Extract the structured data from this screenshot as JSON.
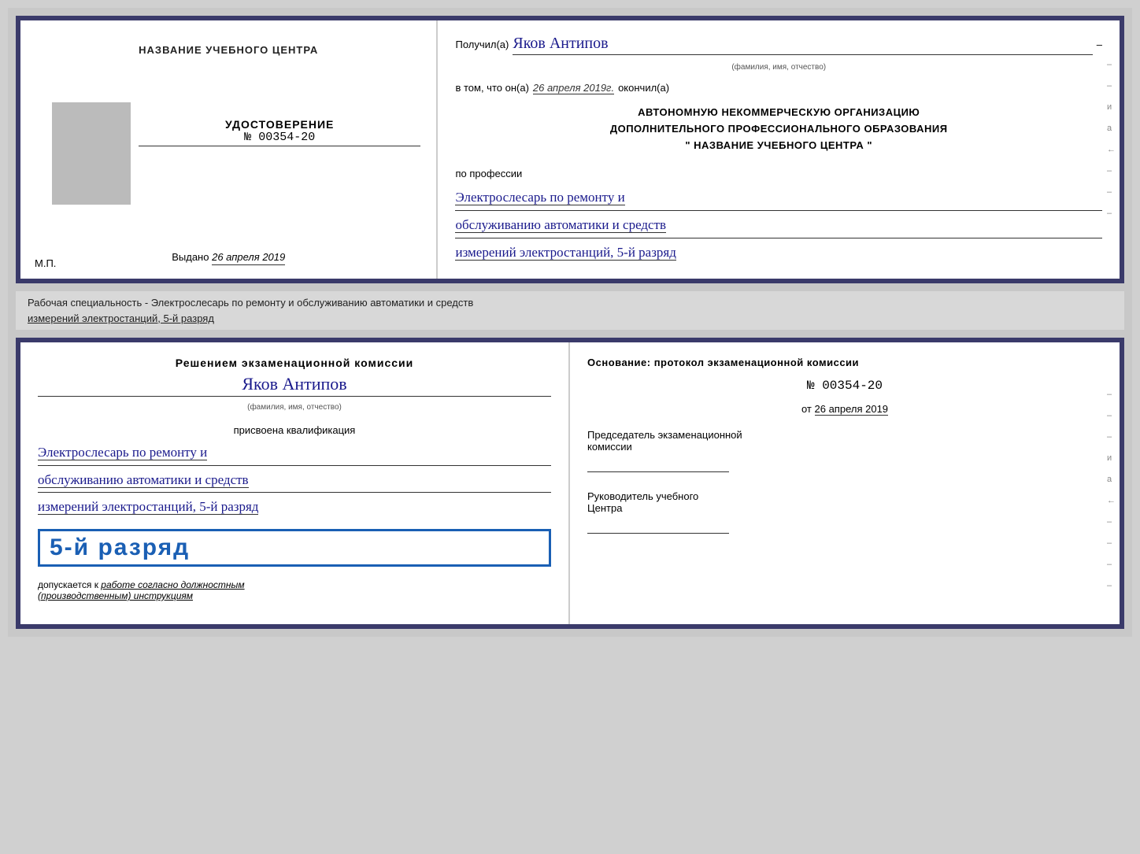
{
  "topDoc": {
    "left": {
      "title": "НАЗВАНИЕ УЧЕБНОГО ЦЕНТРА",
      "udostoverenie": "УДОСТОВЕРЕНИЕ",
      "number": "№ 00354-20",
      "vydano_label": "Выдано",
      "vydano_date": "26 апреля 2019",
      "mp": "М.П."
    },
    "right": {
      "poluchil_label": "Получил(a)",
      "name_handwritten": "Яков Антипов",
      "fio_sub": "(фамилия, имя, отчество)",
      "vtom_label": "в том, что он(а)",
      "vtom_date": "26 апреля 2019г.",
      "okonchil_label": "окончил(а)",
      "org_line1": "АВТОНОМНУЮ НЕКОММЕРЧЕСКУЮ ОРГАНИЗАЦИЮ",
      "org_line2": "ДОПОЛНИТЕЛЬНОГО ПРОФЕССИОНАЛЬНОГО ОБРАЗОВАНИЯ",
      "org_line3": "\"   НАЗВАНИЕ УЧЕБНОГО ЦЕНТРА   \"",
      "po_professii": "по профессии",
      "profession_line1": "Электрослесарь по ремонту и",
      "profession_line2": "обслуживанию автоматики и средств",
      "profession_line3": "измерений электростанций, 5-й разряд"
    }
  },
  "middleText": {
    "line1": "Рабочая специальность - Электрослесарь по ремонту и обслуживанию автоматики и средств",
    "line2": "измерений электростанций, 5-й разряд"
  },
  "bottomDoc": {
    "left": {
      "resheniem": "Решением экзаменационной комиссии",
      "name_handwritten": "Яков Антипов",
      "fio_sub": "(фамилия, имя, отчество)",
      "prisvoena": "присвоена квалификация",
      "kvali_line1": "Электрослесарь по ремонту и",
      "kvali_line2": "обслуживанию автоматики и средств",
      "kvali_line3": "измерений электростанций, 5-й разряд",
      "razryad_badge": "5-й разряд",
      "dopuskaetsya_prefix": "допускается к",
      "dopuskaetsya_underline": "работе согласно должностным",
      "dopuskaetsya_italic": "(производственным) инструкциям"
    },
    "right": {
      "osnovanie": "Основание: протокол экзаменационной комиссии",
      "number": "№ 00354-20",
      "ot_label": "от",
      "ot_date": "26 апреля 2019",
      "chairman_line1": "Председатель экзаменационной",
      "chairman_line2": "комиссии",
      "rukovoditel_line1": "Руководитель учебного",
      "rukovoditel_line2": "Центра"
    }
  }
}
